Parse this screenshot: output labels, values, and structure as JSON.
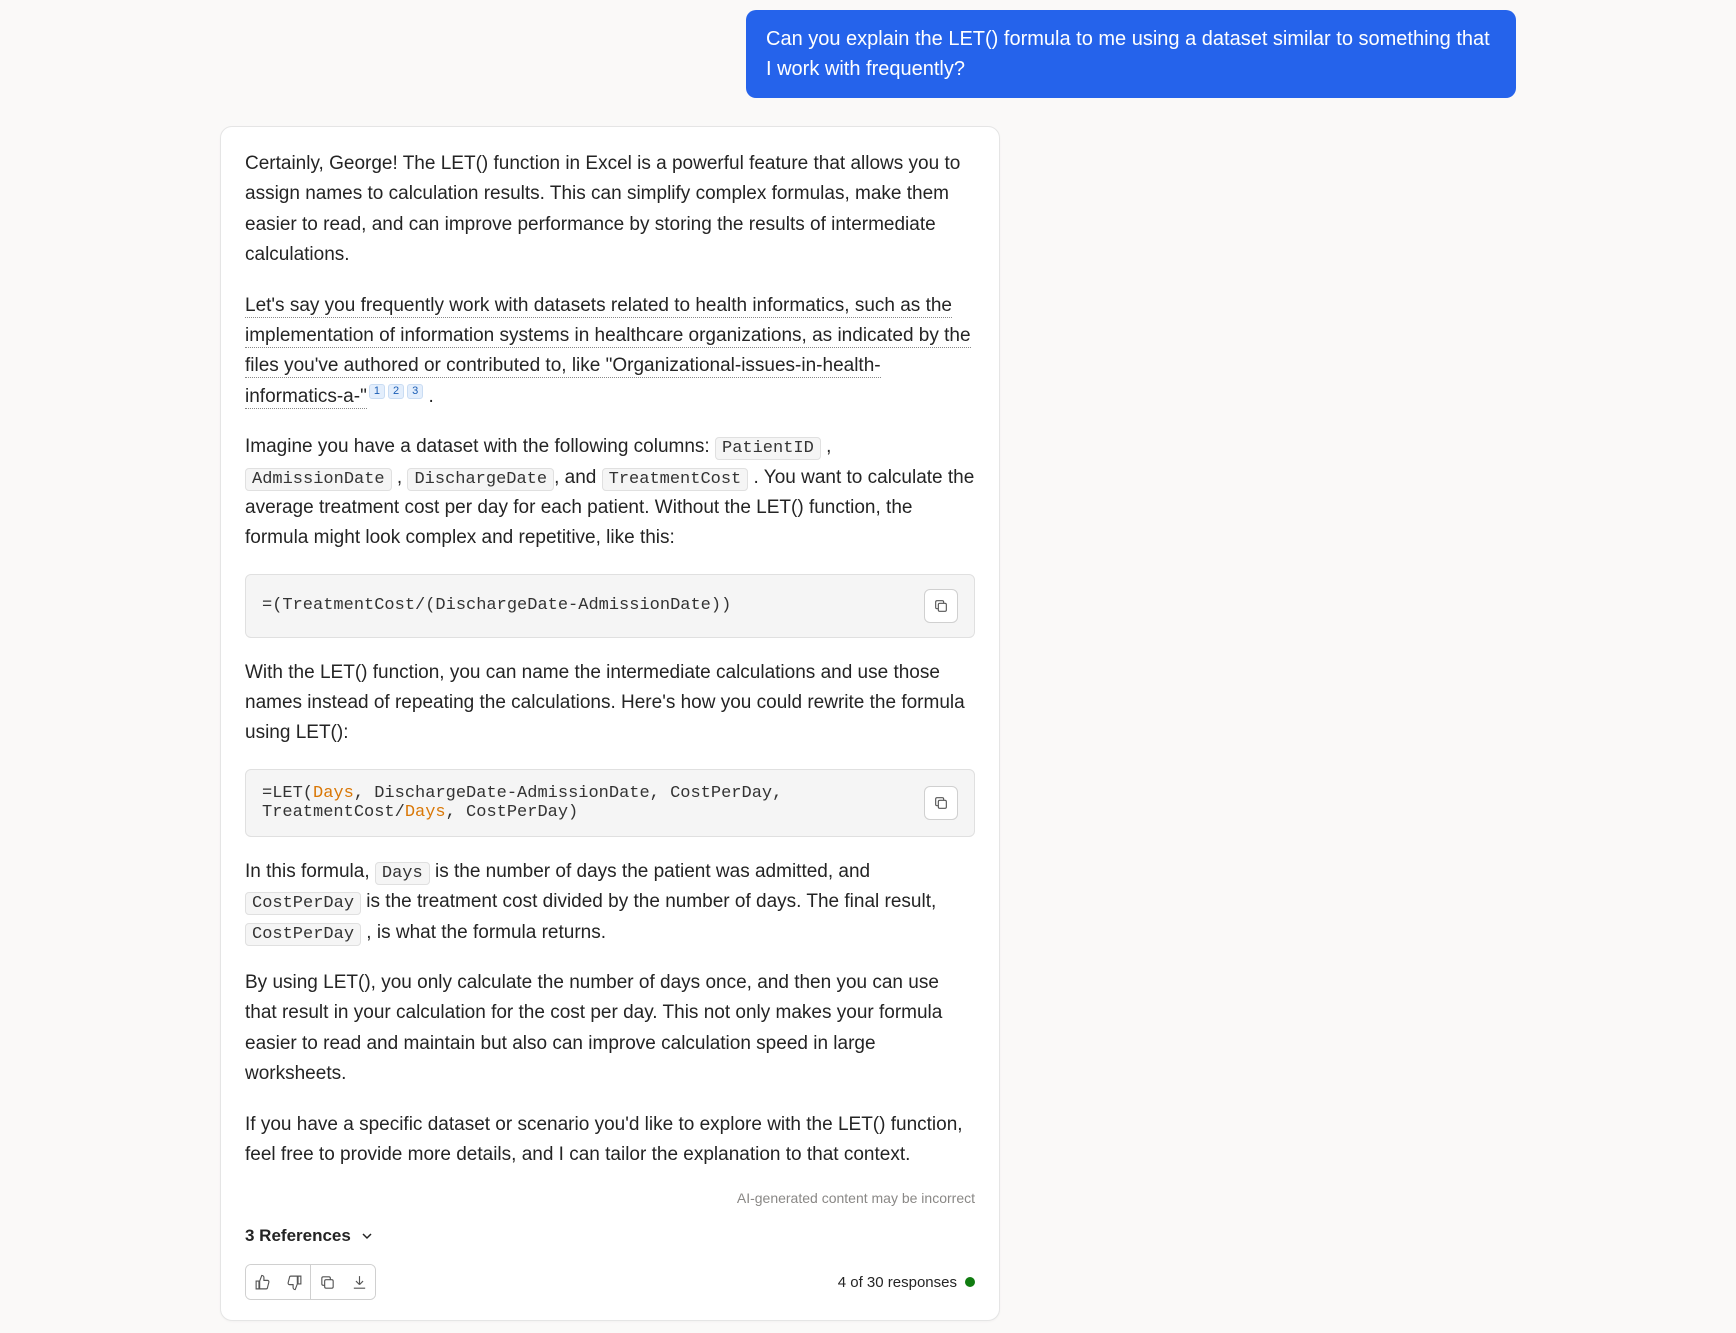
{
  "user_message": "Can you explain the LET() formula to me using a dataset similar to something that I work with frequently?",
  "assistant": {
    "p1": "Certainly, George! The LET() function in Excel is a powerful feature that allows you to assign names to calculation results. This can simplify complex formulas, make them easier to read, and can improve performance by storing the results of intermediate calculations.",
    "p2_underlined": "Let's say you frequently work with datasets related to health informatics, such as the implementation of information systems in healthcare organizations, as indicated by the files you've authored or contributed to, like \"Organizational-issues-in-health-informatics-a-\"",
    "p2_trail": " .",
    "citations": [
      "1",
      "2",
      "3"
    ],
    "p3_a": "Imagine you have a dataset with the following columns: ",
    "p3_cols": [
      "PatientID",
      "AdmissionDate",
      "DischargeDate",
      "TreatmentCost"
    ],
    "p3_sep": " , ",
    "p3_and": ", and ",
    "p3_b": " . You want to calculate the average treatment cost per day for each patient. Without the LET() function, the formula might look complex and repetitive, like this:",
    "code1": "=(TreatmentCost/(DischargeDate-AdmissionDate))",
    "p4": "With the LET() function, you can name the intermediate calculations and use those names instead of repeating the calculations. Here's how you could rewrite the formula using LET():",
    "code2_plain": "=LET(Days, DischargeDate-AdmissionDate, CostPerDay, TreatmentCost/Days, CostPerDay)",
    "code2_pre": "=LET(",
    "code2_hl1": "Days",
    "code2_mid1": ", DischargeDate-AdmissionDate, CostPerDay, TreatmentCost/",
    "code2_hl2": "Days",
    "code2_mid2": ", CostPerDay)",
    "p5_a": "In this formula, ",
    "p5_code1": "Days",
    "p5_b": " is the number of days the patient was admitted, and ",
    "p5_code2": "CostPerDay",
    "p5_c": " is the treatment cost divided by the number of days. The final result, ",
    "p5_code3": "CostPerDay",
    "p5_d": " , is what the formula returns.",
    "p6": "By using LET(), you only calculate the number of days once, and then you can use that result in your calculation for the cost per day. This not only makes your formula easier to read and maintain but also can improve calculation speed in large worksheets.",
    "p7": "If you have a specific dataset or scenario you'd like to explore with the LET() function, feel free to provide more details, and I can tailor the explanation to that context.",
    "disclaimer": "AI-generated content may be incorrect",
    "references_label": "3 References",
    "response_count": "4 of 30 responses"
  }
}
